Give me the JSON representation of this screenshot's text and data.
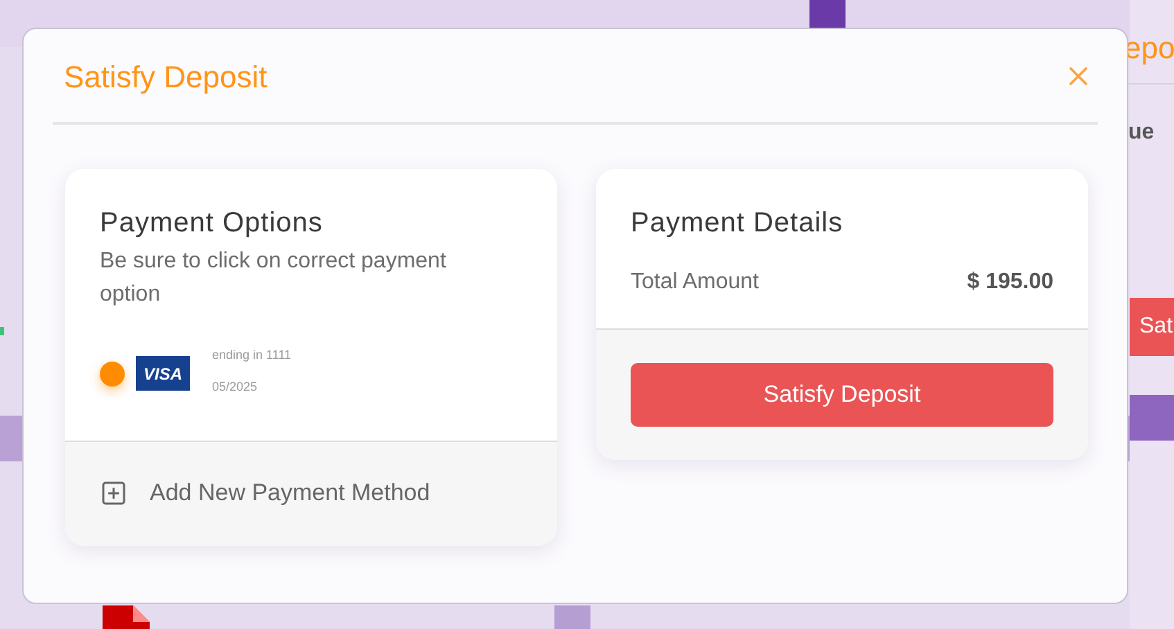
{
  "background": {
    "side_title": "epo",
    "side_label": "ue",
    "side_button": "Sat"
  },
  "modal": {
    "title": "Satisfy Deposit",
    "payment_options": {
      "title": "Payment Options",
      "hint": "Be sure to click on correct payment option",
      "methods": [
        {
          "brand": "VISA",
          "selected": true,
          "ending": "ending in 1111",
          "expiry": "05/2025"
        }
      ],
      "add_label": "Add New Payment Method"
    },
    "payment_details": {
      "title": "Payment Details",
      "total_label": "Total Amount",
      "total_value": "$ 195.00",
      "button": "Satisfy Deposit"
    }
  }
}
